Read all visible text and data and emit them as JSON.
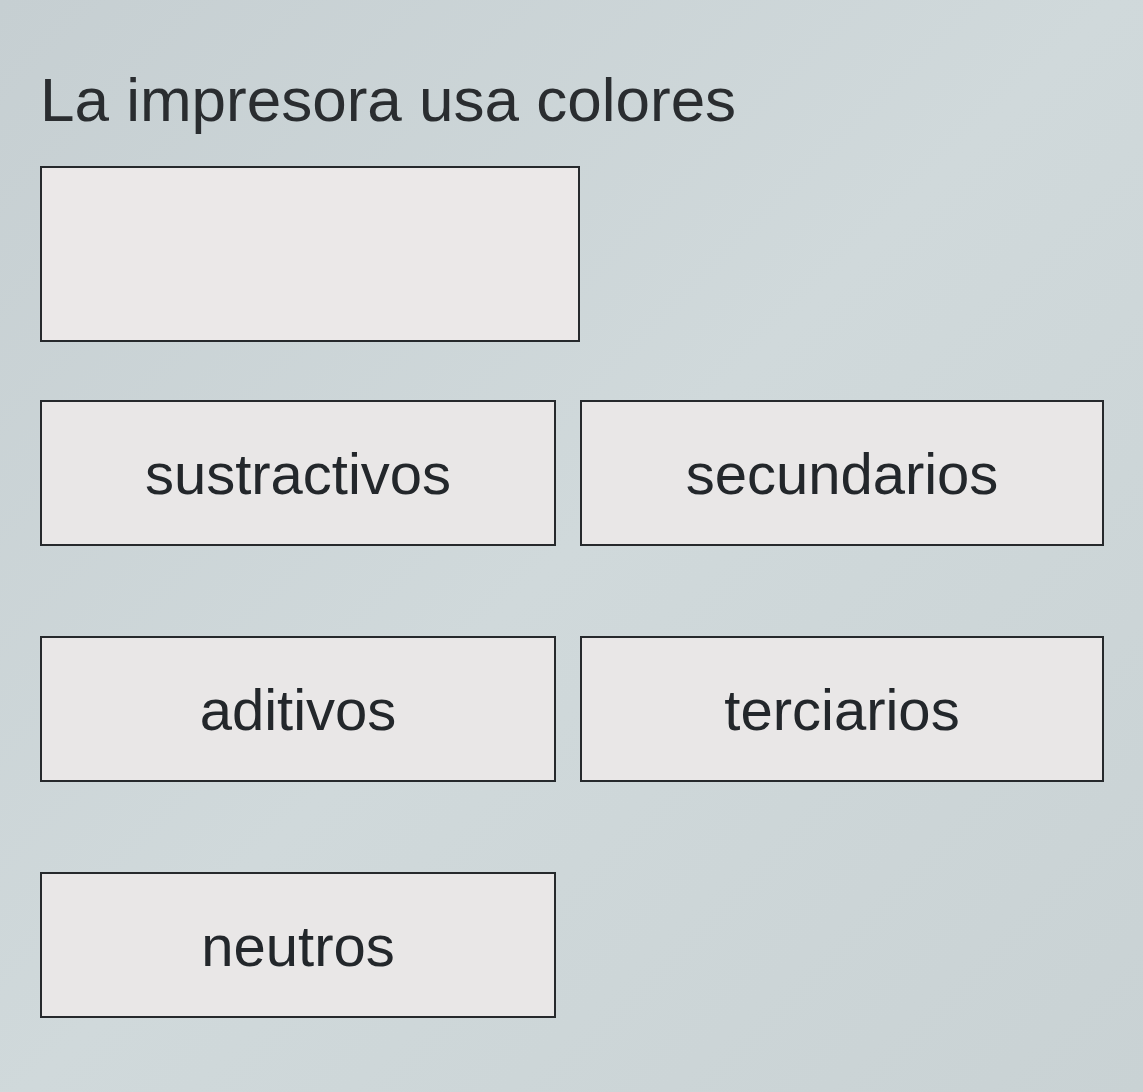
{
  "prompt": "La impresora usa colores",
  "options": [
    {
      "label": "sustractivos"
    },
    {
      "label": "secundarios"
    },
    {
      "label": "aditivos"
    },
    {
      "label": "terciarios"
    },
    {
      "label": "neutros"
    }
  ]
}
